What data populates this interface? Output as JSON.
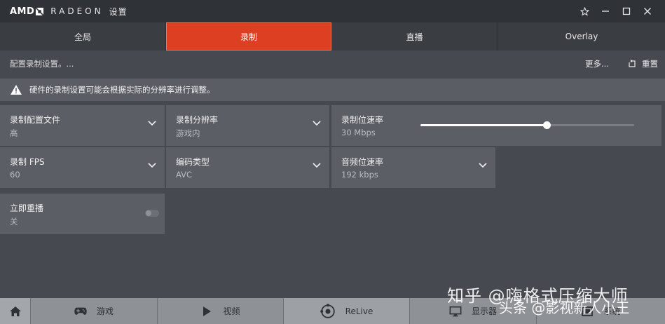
{
  "titlebar": {
    "brand_amd": "AMD",
    "brand_radeon": "RADEON",
    "brand_settings": "设置",
    "controls": [
      "star-icon",
      "minimize-icon",
      "maximize-icon",
      "close-icon"
    ]
  },
  "tabs": [
    {
      "label": "全局",
      "active": false
    },
    {
      "label": "录制",
      "active": true
    },
    {
      "label": "直播",
      "active": false
    },
    {
      "label": "Overlay",
      "active": false
    }
  ],
  "toolbar": {
    "description": "配置录制设置。...",
    "more_label": "更多...",
    "reset_label": "重置"
  },
  "warning": {
    "text": "硬件的录制设置可能会根据实际的分辨率进行调整。"
  },
  "settings": {
    "profile": {
      "label": "录制配置文件",
      "value": "高"
    },
    "resolution": {
      "label": "录制分辨率",
      "value": "游戏内"
    },
    "bitrate": {
      "label": "录制位速率",
      "value": "30 Mbps",
      "slider_fraction": 0.59
    },
    "fps": {
      "label": "录制 FPS",
      "value": "60"
    },
    "encoding": {
      "label": "编码类型",
      "value": "AVC"
    },
    "audio_bitrate": {
      "label": "音频位速率",
      "value": "192 kbps"
    },
    "instant_replay": {
      "label": "立即重播",
      "value": "关",
      "enabled": false
    }
  },
  "bottomnav": {
    "home_icon": "home-icon",
    "items": [
      {
        "label": "游戏",
        "icon": "gamepad-icon"
      },
      {
        "label": "视频",
        "icon": "play-icon"
      },
      {
        "label": "ReLive",
        "icon": "relive-icon"
      },
      {
        "label": "显示器",
        "icon": "monitor-icon"
      },
      {
        "label": "系统",
        "icon": "system-icon"
      }
    ]
  },
  "watermark": {
    "line1": "知乎 @嗨格式压缩大师",
    "line2": "头条 @影视新人小王"
  },
  "colors": {
    "accent": "#dc3f22",
    "background": "#464a50",
    "card": "#5b5f65",
    "titlebar": "#2f3237"
  }
}
